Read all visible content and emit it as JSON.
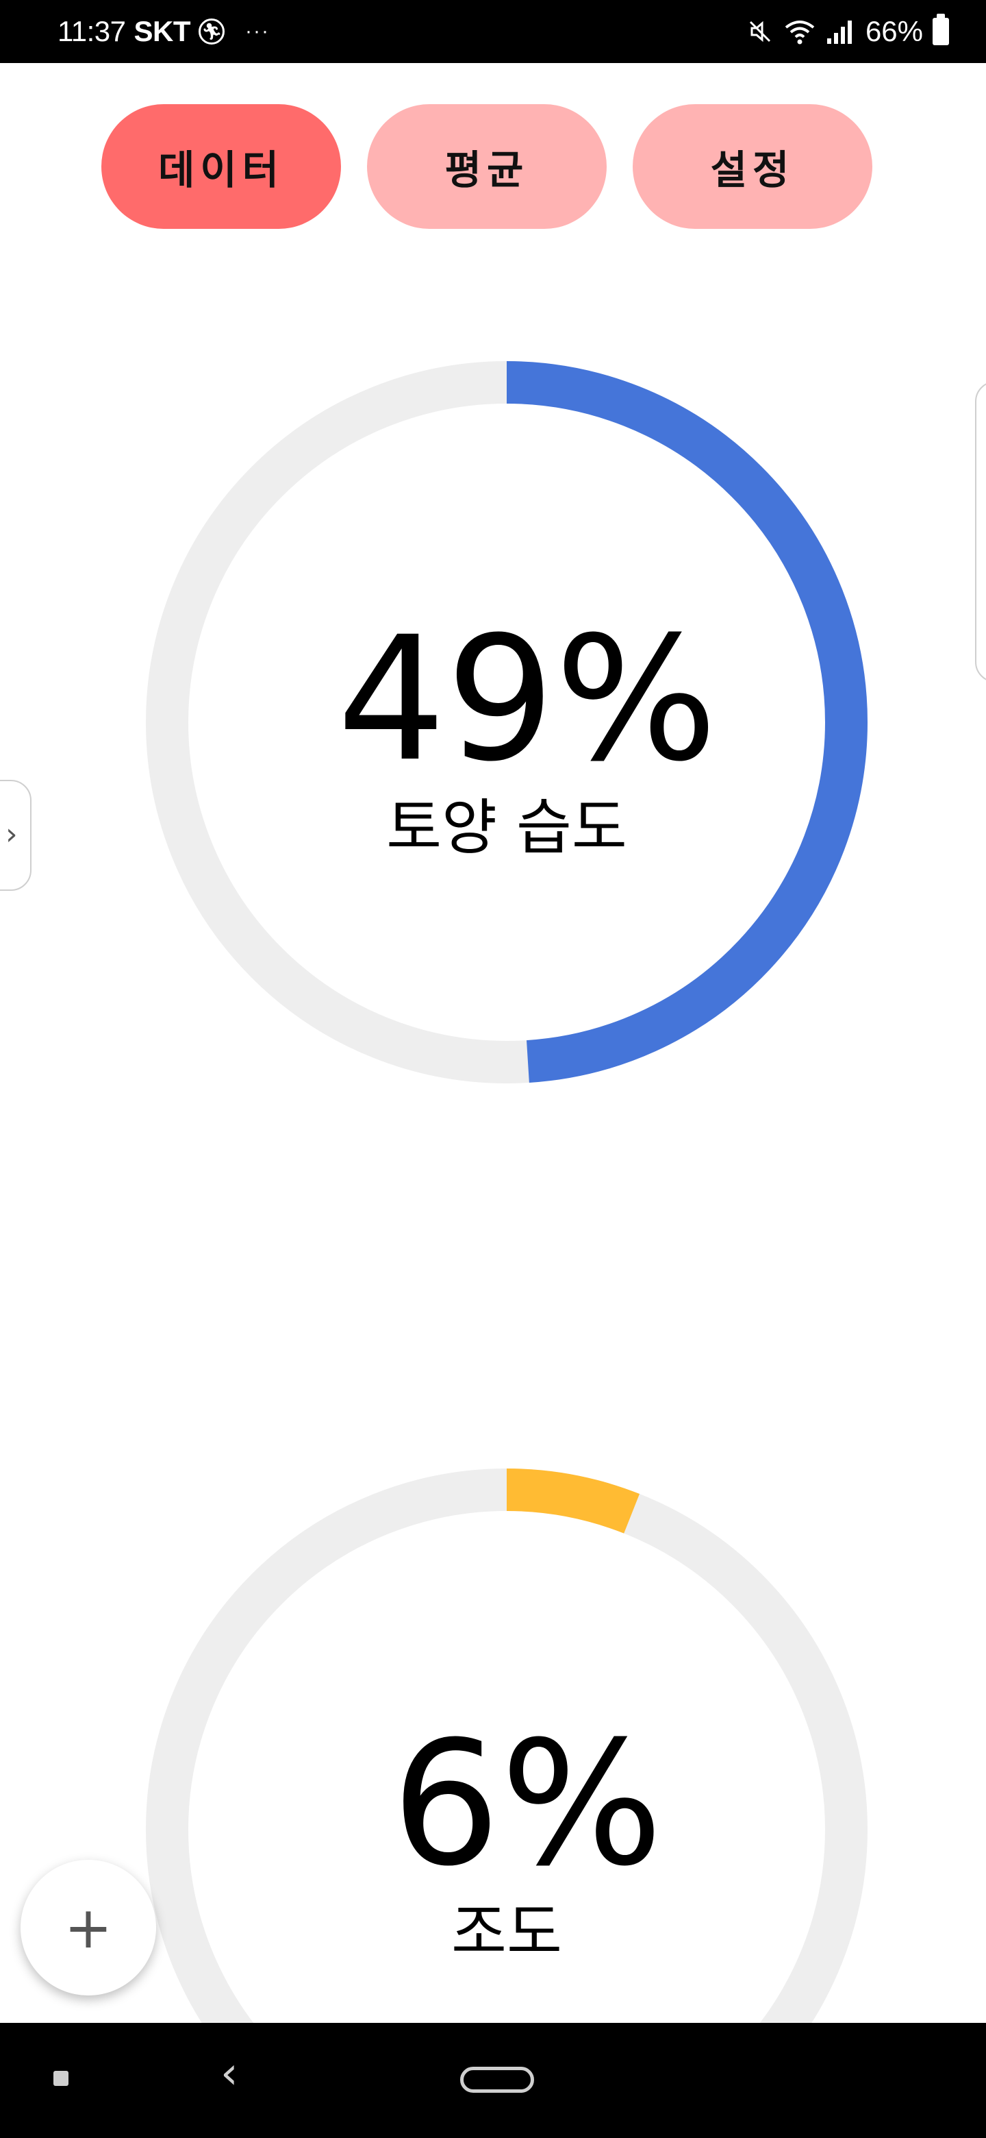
{
  "status_bar": {
    "time": "11:37",
    "carrier": "SKT",
    "overflow": "···",
    "battery": "66%",
    "icons": [
      "runner-icon",
      "mute-icon",
      "wifi-icon",
      "signal-icon",
      "battery-icon"
    ]
  },
  "tabs": [
    {
      "label": "데이터",
      "active": true
    },
    {
      "label": "평균",
      "active": false
    },
    {
      "label": "설정",
      "active": false
    }
  ],
  "gauges": [
    {
      "value_text": "49%",
      "label": "토양 습도",
      "fraction": 0.49,
      "color": "#4575d9"
    },
    {
      "value_text": "6%",
      "label": "조도",
      "fraction": 0.06,
      "color": "#ffbb33"
    }
  ],
  "colors": {
    "tab_active": "#ff6b6b",
    "tab_inactive": "#ffb3b3",
    "track": "#eeeeee"
  },
  "fab": {
    "icon": "plus-icon",
    "symbol": "+"
  },
  "side_handle": {
    "icon": "chevron-right-icon",
    "symbol": "›"
  },
  "nav_bar": {
    "back_symbol": "‹"
  }
}
